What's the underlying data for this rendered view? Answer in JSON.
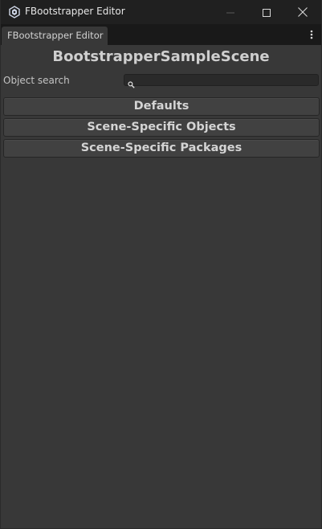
{
  "window": {
    "title": "FBootstrapper Editor",
    "controls": {
      "minimize_icon": "minimize-icon",
      "maximize_icon": "maximize-icon",
      "close_icon": "close-icon"
    },
    "app_icon": "unity-icon"
  },
  "tabbar": {
    "tabs": [
      {
        "label": "FBootstrapper Editor"
      }
    ],
    "menu_icon": "kebab-menu-icon"
  },
  "main": {
    "scene_title": "BootstrapperSampleScene",
    "search": {
      "label": "Object search",
      "value": "",
      "icon": "search-icon"
    },
    "sections": [
      {
        "label": "Defaults"
      },
      {
        "label": "Scene-Specific Objects"
      },
      {
        "label": "Scene-Specific Packages"
      }
    ]
  },
  "colors": {
    "background": "#383838",
    "titlebar": "#202020",
    "tabbar": "#191919",
    "button": "#414141",
    "text": "#d4d4d4"
  }
}
